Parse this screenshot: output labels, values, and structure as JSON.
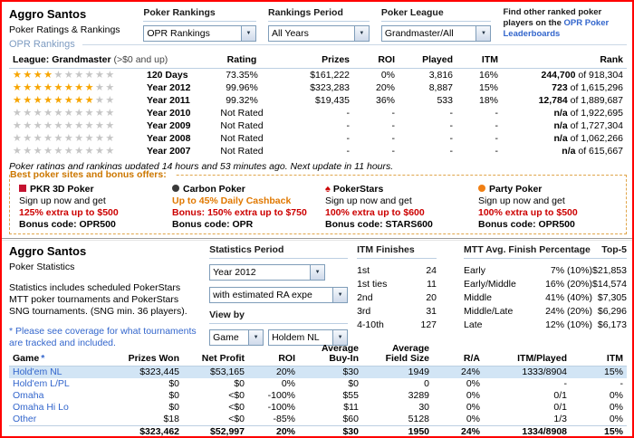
{
  "colors": {
    "page_border": "#FF0000",
    "link_blue": "#3366CC",
    "section_blue": "#7D9BC1",
    "underline_blue": "#BCCFE2",
    "star_gold": "#F7A500",
    "star_gray": "#C6C6C6",
    "accent_red": "#CC0000",
    "offers_orange": "#CC7700",
    "offers_border": "#E0A54A",
    "carbon_orange": "#E07800",
    "row_highlight": "#D2E5F5"
  },
  "header": {
    "player_name": "Aggro Santos",
    "subtitle": "Poker Ratings & Rankings",
    "filters": [
      {
        "label": "Poker Rankings",
        "value": "OPR Rankings"
      },
      {
        "label": "Rankings Period",
        "value": "All Years"
      },
      {
        "label": "Poker League",
        "value": "Grandmaster/All"
      }
    ],
    "find_text": "Find other ranked poker players on the",
    "find_link": "OPR Poker Leaderboards"
  },
  "rankings": {
    "section_title": "OPR Rankings",
    "league_label": "League:",
    "league_name": "Grandmaster",
    "league_range": "(>$0 and up)",
    "columns": [
      "Rating",
      "Prizes",
      "ROI",
      "Played",
      "ITM",
      "Rank"
    ],
    "stars_max": 10,
    "rows": [
      {
        "stars": 4,
        "period": "120 Days",
        "rating": "73.35%",
        "prizes": "$161,222",
        "roi": "0%",
        "played": "3,816",
        "itm": "16%",
        "rank_value": "244,700",
        "rank_total": "of 918,304"
      },
      {
        "stars": 8,
        "period": "Year 2012",
        "rating": "99.96%",
        "prizes": "$323,283",
        "roi": "20%",
        "played": "8,887",
        "itm": "15%",
        "rank_value": "723",
        "rank_total": "of 1,615,296"
      },
      {
        "stars": 8,
        "period": "Year 2011",
        "rating": "99.32%",
        "prizes": "$19,435",
        "roi": "36%",
        "played": "533",
        "itm": "18%",
        "rank_value": "12,784",
        "rank_total": "of 1,889,687"
      },
      {
        "stars": 0,
        "period": "Year 2010",
        "rating": "Not Rated",
        "prizes": "-",
        "roi": "-",
        "played": "-",
        "itm": "-",
        "rank_value": "n/a",
        "rank_total": "of 1,922,695"
      },
      {
        "stars": 0,
        "period": "Year 2009",
        "rating": "Not Rated",
        "prizes": "-",
        "roi": "-",
        "played": "-",
        "itm": "-",
        "rank_value": "n/a",
        "rank_total": "of 1,727,304"
      },
      {
        "stars": 0,
        "period": "Year 2008",
        "rating": "Not Rated",
        "prizes": "-",
        "roi": "-",
        "played": "-",
        "itm": "-",
        "rank_value": "n/a",
        "rank_total": "of 1,062,266"
      },
      {
        "stars": 0,
        "period": "Year 2007",
        "rating": "Not Rated",
        "prizes": "-",
        "roi": "-",
        "played": "-",
        "itm": "-",
        "rank_value": "n/a",
        "rank_total": "of 615,667"
      }
    ],
    "update_note": "Poker ratings and rankings updated 14 hours and 53 minutes ago. Next update in 11 hours."
  },
  "offers": {
    "title": "Best poker sites and bonus offers:",
    "items": [
      {
        "name": "PKR 3D Poker",
        "icon": "pkr-logo-icon",
        "line1": "Sign up now and get",
        "line2": "125% extra up to $500",
        "bonus_label": "Bonus code:",
        "bonus_code": "OPR500"
      },
      {
        "name": "Carbon Poker",
        "icon": "carbon-logo-icon",
        "line1": "Up to 45% Daily Cashback",
        "line2": "Bonus: 150% extra up to $750",
        "bonus_label": "Bonus code:",
        "bonus_code": "OPR"
      },
      {
        "name": "PokerStars",
        "icon": "pokerstars-spade-icon",
        "line1": "Sign up now and get",
        "line2": "100% extra up to $600",
        "bonus_label": "Bonus code:",
        "bonus_code": "STARS600"
      },
      {
        "name": "Party Poker",
        "icon": "party-logo-icon",
        "line1": "Sign up now and get",
        "line2": "100% extra up to $500",
        "bonus_label": "Bonus code:",
        "bonus_code": "OPR500"
      }
    ]
  },
  "stats": {
    "player_name": "Aggro Santos",
    "subtitle": "Poker Statistics",
    "description": "Statistics includes scheduled PokerStars MTT poker tournaments and PokerStars SNG tournaments. (SNG min. 36 players).",
    "coverage_prefix": "* Please see",
    "coverage_link": "coverage",
    "coverage_suffix": "for what tournaments are tracked and included.",
    "period": {
      "header": "Statistics Period",
      "period_value": "Year 2012",
      "ra_value": "with estimated RA expe",
      "view_by_label": "View by",
      "view_value": "Game",
      "game_value": "Holdem NL"
    },
    "itm_finishes": {
      "header": "ITM Finishes",
      "rows": [
        {
          "label": "1st",
          "value": "24"
        },
        {
          "label": "1st ties",
          "value": "11"
        },
        {
          "label": "2nd",
          "value": "20"
        },
        {
          "label": "3rd",
          "value": "31"
        },
        {
          "label": "4-10th",
          "value": "127"
        }
      ]
    },
    "mtt_finish": {
      "header": "MTT Avg. Finish Percentage",
      "top5_header": "Top-5",
      "rows": [
        {
          "label": "Early",
          "pct": "7% (10%)",
          "top5": "$21,853"
        },
        {
          "label": "Early/Middle",
          "pct": "16% (20%)",
          "top5": "$14,574"
        },
        {
          "label": "Middle",
          "pct": "41% (40%)",
          "top5": "$7,305"
        },
        {
          "label": "Middle/Late",
          "pct": "24% (20%)",
          "top5": "$6,296"
        },
        {
          "label": "Late",
          "pct": "12% (10%)",
          "top5": "$6,173"
        }
      ]
    }
  },
  "games": {
    "header_game": "Game",
    "header_game_note": "*",
    "columns": [
      {
        "l1": "Prizes Won"
      },
      {
        "l1": "Net Profit"
      },
      {
        "l1": "ROI"
      },
      {
        "l1": "Average",
        "l2": "Buy-In"
      },
      {
        "l1": "Average",
        "l2": "Field Size"
      },
      {
        "l1": "R/A"
      },
      {
        "l1": "ITM/Played"
      },
      {
        "l1": "ITM"
      }
    ],
    "rows": [
      {
        "game": "Hold'em NL",
        "highlight": true,
        "prizes": "$323,445",
        "net": "$53,165",
        "roi": "20%",
        "buyin": "$30",
        "field": "1949",
        "ra": "24%",
        "itm_played": "1333/8904",
        "itm": "15%"
      },
      {
        "game": "Hold'em L/PL",
        "highlight": false,
        "prizes": "$0",
        "net": "$0",
        "roi": "0%",
        "buyin": "$0",
        "field": "0",
        "ra": "0%",
        "itm_played": "-",
        "itm": "-"
      },
      {
        "game": "Omaha",
        "highlight": false,
        "prizes": "$0",
        "net": "<$0",
        "roi": "-100%",
        "buyin": "$55",
        "field": "3289",
        "ra": "0%",
        "itm_played": "0/1",
        "itm": "0%"
      },
      {
        "game": "Omaha Hi Lo",
        "highlight": false,
        "prizes": "$0",
        "net": "<$0",
        "roi": "-100%",
        "buyin": "$11",
        "field": "30",
        "ra": "0%",
        "itm_played": "0/1",
        "itm": "0%"
      },
      {
        "game": "Other",
        "highlight": false,
        "prizes": "$18",
        "net": "<$0",
        "roi": "-85%",
        "buyin": "$60",
        "field": "5128",
        "ra": "0%",
        "itm_played": "1/3",
        "itm": "0%"
      }
    ],
    "total_row": {
      "prizes": "$323,462",
      "net": "$52,997",
      "roi": "20%",
      "buyin": "$30",
      "field": "1950",
      "ra": "24%",
      "itm_played": "1334/8908",
      "itm": "15%"
    }
  }
}
